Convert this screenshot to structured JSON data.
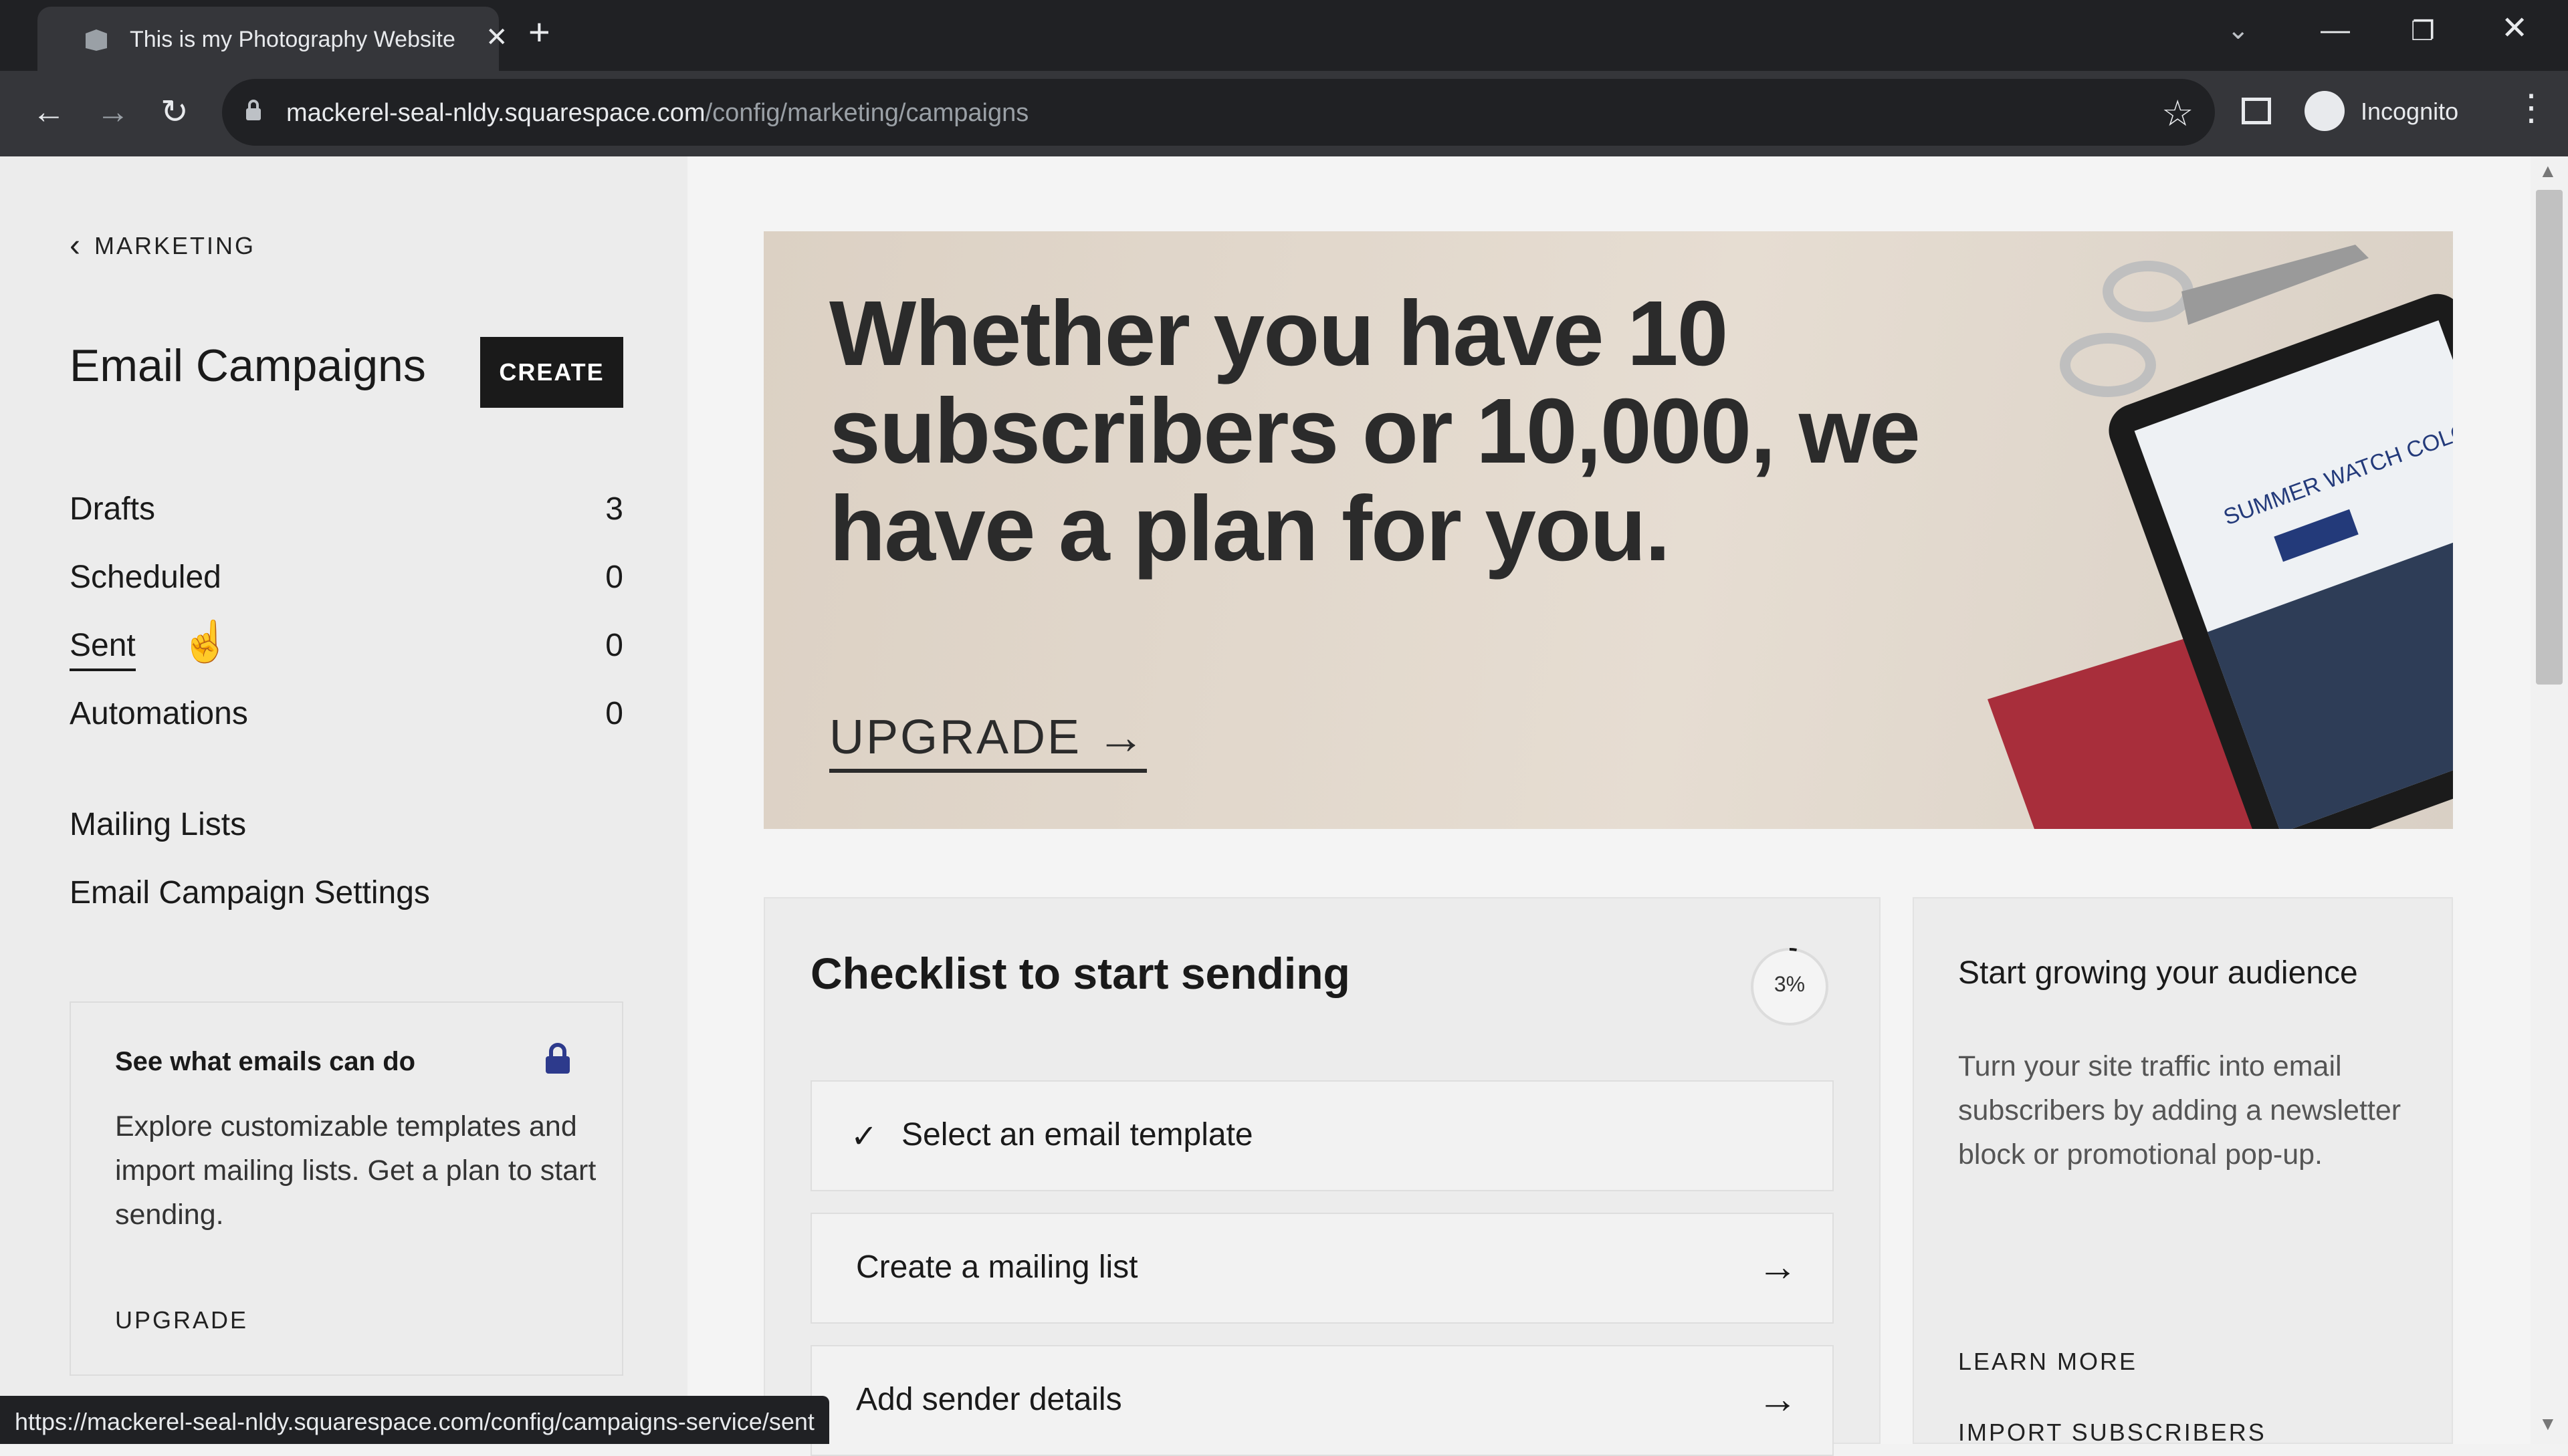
{
  "browser": {
    "tab_title": "This is my Photography Website",
    "url_host": "mackerel-seal-nldy.squarespace.com",
    "url_path": "/config/marketing/campaigns",
    "profile_label": "Incognito",
    "status_url": "https://mackerel-seal-nldy.squarespace.com/config/campaigns-service/sent"
  },
  "sidebar": {
    "back_label": "MARKETING",
    "title": "Email Campaigns",
    "create_label": "CREATE",
    "items": [
      {
        "label": "Drafts",
        "count": "3"
      },
      {
        "label": "Scheduled",
        "count": "0"
      },
      {
        "label": "Sent",
        "count": "0"
      },
      {
        "label": "Automations",
        "count": "0"
      }
    ],
    "links": [
      "Mailing Lists",
      "Email Campaign Settings"
    ],
    "promo": {
      "title": "See what emails can do",
      "body": "Explore customizable templates and import mailing lists. Get a plan to start sending.",
      "cta": "UPGRADE"
    }
  },
  "hero": {
    "headline": "Whether you have 10 subscribers or 10,000, we have a plan for you.",
    "cta": "UPGRADE",
    "tablet_text": "SUMMER WATCH COLOR SERIES"
  },
  "checklist": {
    "title": "Checklist to start sending",
    "progress_label": "3%",
    "progress_value": 0.03,
    "items": [
      {
        "label": "Select an email template",
        "done": true
      },
      {
        "label": "Create a mailing list",
        "done": false
      },
      {
        "label": "Add sender details",
        "done": false
      }
    ]
  },
  "audience": {
    "title": "Start growing your audience",
    "body": "Turn your site traffic into email subscribers by adding a newsletter block or promotional pop-up.",
    "learn_more": "LEARN MORE",
    "import": "IMPORT SUBSCRIBERS"
  }
}
